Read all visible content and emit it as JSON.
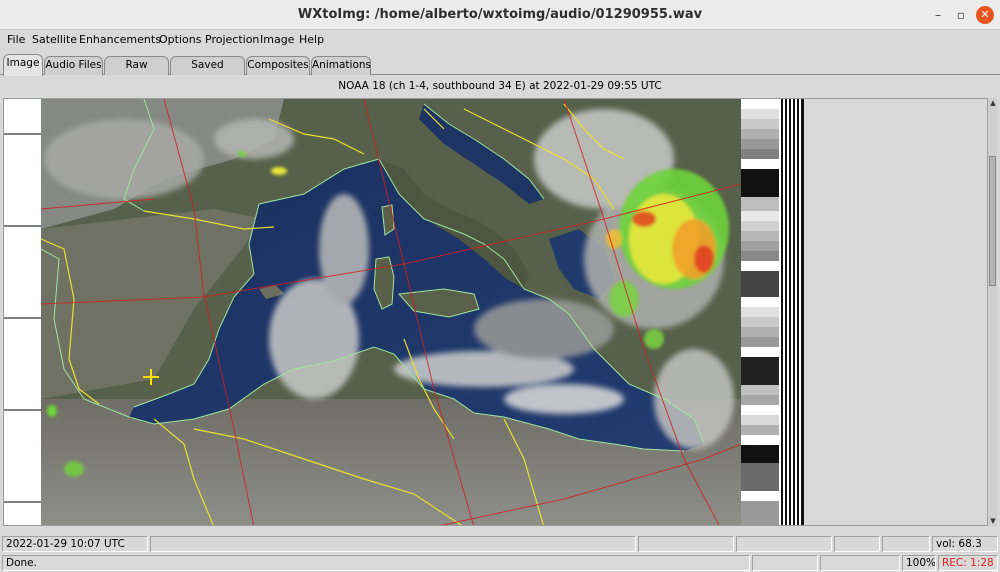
{
  "window": {
    "title": "WXtoImg: /home/alberto/wxtoimg/audio/01290955.wav",
    "minimize_symbol": "–",
    "maximize_symbol": "▫",
    "close_symbol": "✕"
  },
  "menu": {
    "items": [
      {
        "label": "File"
      },
      {
        "label": "Satellite"
      },
      {
        "label": "Enhancements"
      },
      {
        "label": "Options"
      },
      {
        "label": "Projection"
      },
      {
        "label": "Image"
      },
      {
        "label": "Help"
      }
    ]
  },
  "tabs": [
    {
      "label": "Image",
      "active": true
    },
    {
      "label": "Audio Files",
      "active": false
    },
    {
      "label": "Raw Images",
      "active": false
    },
    {
      "label": "Saved Images",
      "active": false
    },
    {
      "label": "Composites",
      "active": false
    },
    {
      "label": "Animations",
      "active": false
    }
  ],
  "image_header": "NOAA 18 (ch 1-4, southbound 34 E) at 2022-01-29  09:55 UTC",
  "status": {
    "datetime": "2022-01-29  10:07 UTC",
    "volume": "vol: 68.3",
    "message": "Done.",
    "progress": "100%",
    "rec": "REC: 1:28"
  },
  "colors": {
    "sea": "#1d3768",
    "land": "#4e5a3e",
    "desert": "#8a8a84",
    "border_lines": "#e8e030",
    "coast_lines": "#90e090",
    "grid_lines": "#d02020",
    "rec_text": "#e02020",
    "close_button": "#e95420"
  }
}
